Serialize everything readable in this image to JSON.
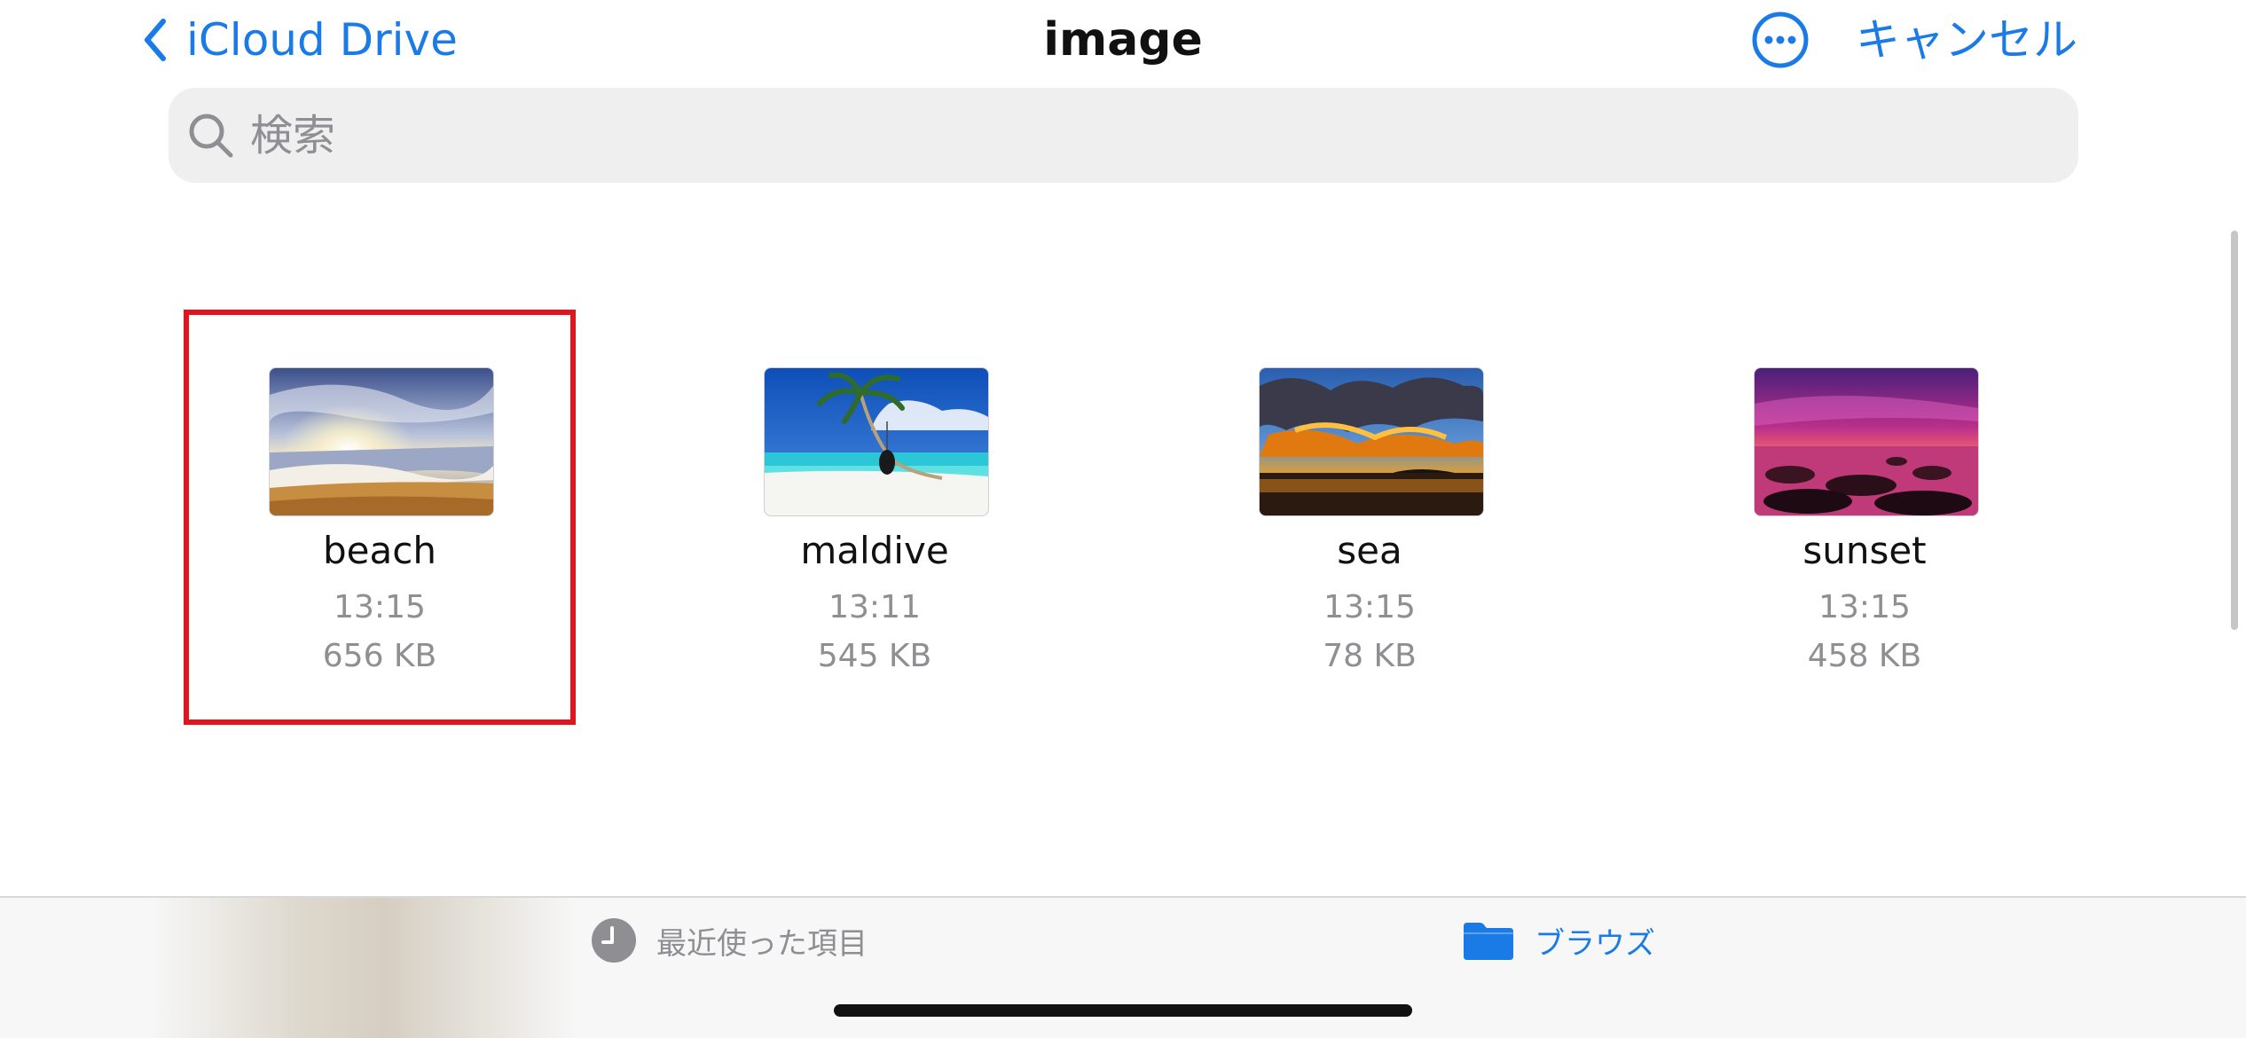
{
  "nav": {
    "back_label": "iCloud Drive",
    "title": "image",
    "cancel_label": "キャンセル"
  },
  "search": {
    "placeholder": "検索"
  },
  "files": [
    {
      "name": "beach",
      "time": "13:15",
      "size": "656 KB",
      "selected": true
    },
    {
      "name": "maldive",
      "time": "13:11",
      "size": "545 KB",
      "selected": false
    },
    {
      "name": "sea",
      "time": "13:15",
      "size": "78 KB",
      "selected": false
    },
    {
      "name": "sunset",
      "time": "13:15",
      "size": "458 KB",
      "selected": false
    }
  ],
  "tabbar": {
    "recent_label": "最近使った項目",
    "browse_label": "ブラウズ",
    "active_tab": "ブラウズ"
  },
  "colors": {
    "accent": "#1a7be6",
    "selection": "#e3141c",
    "secondary_text": "#8e8e93"
  },
  "icons": {
    "back": "chevron-left-icon",
    "more": "ellipsis-circle-icon",
    "search": "magnifying-glass-icon",
    "recent": "clock-icon",
    "browse": "folder-icon"
  }
}
